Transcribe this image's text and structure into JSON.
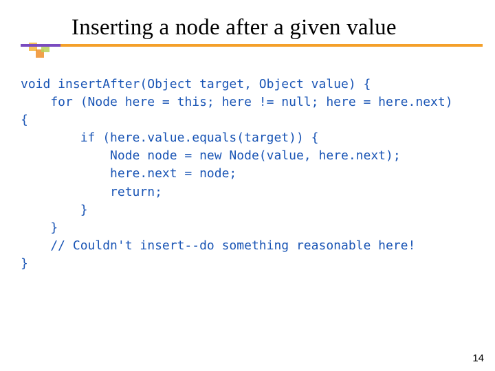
{
  "slide": {
    "title": "Inserting a node after a given value",
    "page_number": "14"
  },
  "code": {
    "l1": "void insertAfter(Object target, Object value) {",
    "l2": "    for (Node here = this; here != null; here = here.next)",
    "l3": "{",
    "l4": "        if (here.value.equals(target)) {",
    "l5": "            Node node = new Node(value, here.next);",
    "l6": "            here.next = node;",
    "l7": "            return;",
    "l8": "        }",
    "l9": "    }",
    "l10": "    // Couldn't insert--do something reasonable here!",
    "l11": "}"
  }
}
